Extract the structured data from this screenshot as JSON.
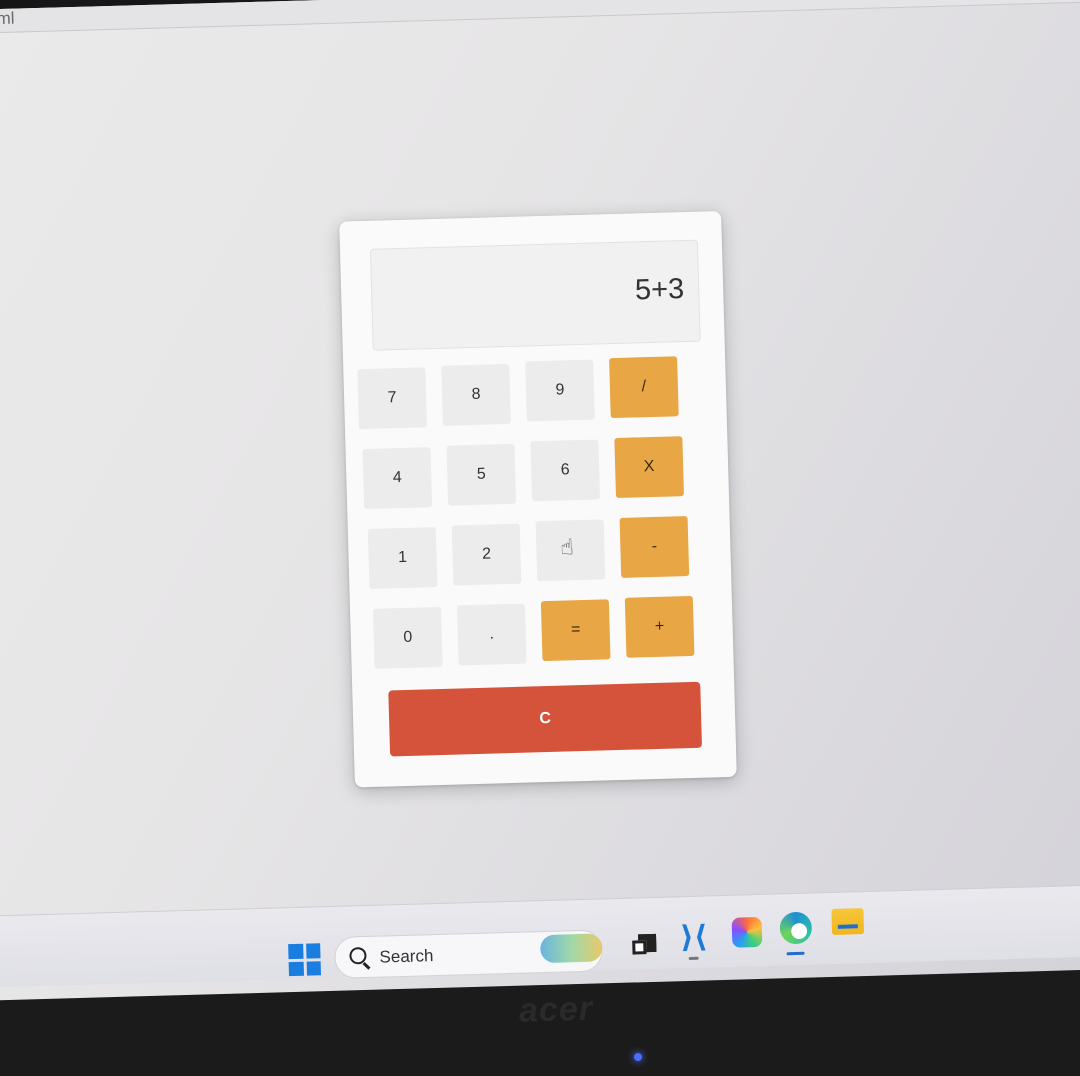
{
  "browser": {
    "tab_label": "html"
  },
  "calculator": {
    "display_value": "5+3",
    "rows": [
      [
        {
          "label": "7",
          "type": "num"
        },
        {
          "label": "8",
          "type": "num"
        },
        {
          "label": "9",
          "type": "num"
        },
        {
          "label": "/",
          "type": "op"
        }
      ],
      [
        {
          "label": "4",
          "type": "num"
        },
        {
          "label": "5",
          "type": "num"
        },
        {
          "label": "6",
          "type": "num"
        },
        {
          "label": "X",
          "type": "op"
        }
      ],
      [
        {
          "label": "1",
          "type": "num"
        },
        {
          "label": "2",
          "type": "num"
        },
        {
          "label": "",
          "type": "num"
        },
        {
          "label": "-",
          "type": "op"
        }
      ],
      [
        {
          "label": "0",
          "type": "num"
        },
        {
          "label": ".",
          "type": "num"
        },
        {
          "label": "=",
          "type": "op"
        },
        {
          "label": "+",
          "type": "op"
        }
      ]
    ],
    "clear_label": "C",
    "colors": {
      "number_key": "#ececec",
      "operator_key": "#e8a644",
      "clear_key": "#d4533a"
    }
  },
  "taskbar": {
    "search_placeholder": "Search",
    "icons": [
      "windows-start-icon",
      "search-icon",
      "news-widget-icon",
      "task-view-icon",
      "vscode-icon",
      "copilot-icon",
      "edge-icon",
      "file-explorer-icon"
    ]
  },
  "bezel": {
    "brand": "acer"
  }
}
